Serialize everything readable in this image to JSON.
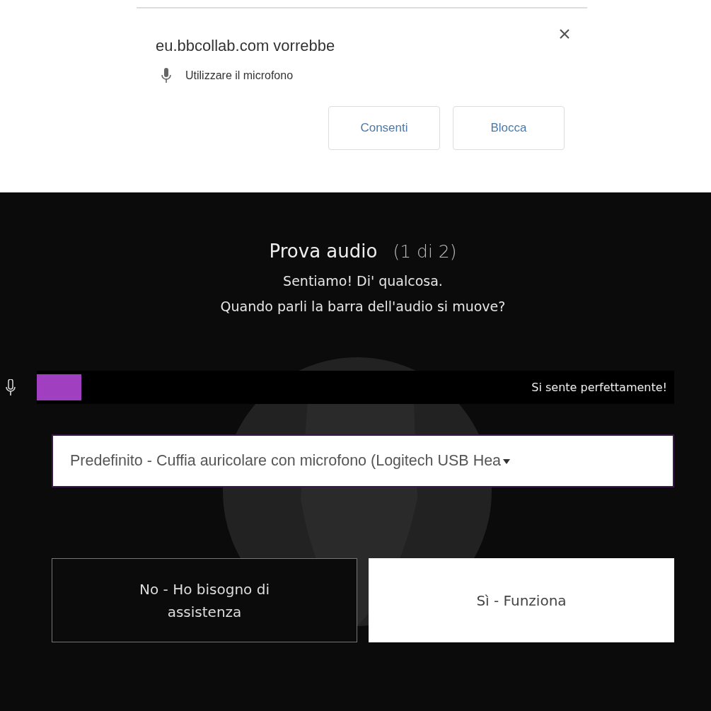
{
  "permission_prompt": {
    "message": "eu.bbcollab.com vorrebbe",
    "permission": "Utilizzare il microfono",
    "buttons": [
      "Consenti",
      "Blocca"
    ]
  },
  "audio_test": {
    "title": "Prova audio",
    "step": "(1 di 2)",
    "lines": [
      "Sentiamo! Di' qualcosa.",
      "Quando parli la barra dell'audio si muove?"
    ],
    "meter": {
      "level": 0.07,
      "reading": "Si sente perfettamente!"
    },
    "device_select": {
      "value": "Predefinito - Cuffia auricolare con microfono (Logitech USB Hea"
    },
    "buttons": [
      {
        "label": "No - Ho bisogno di assistenza",
        "kind": "secondary"
      },
      {
        "label": "Sì - Funziona",
        "kind": "primary"
      }
    ]
  }
}
